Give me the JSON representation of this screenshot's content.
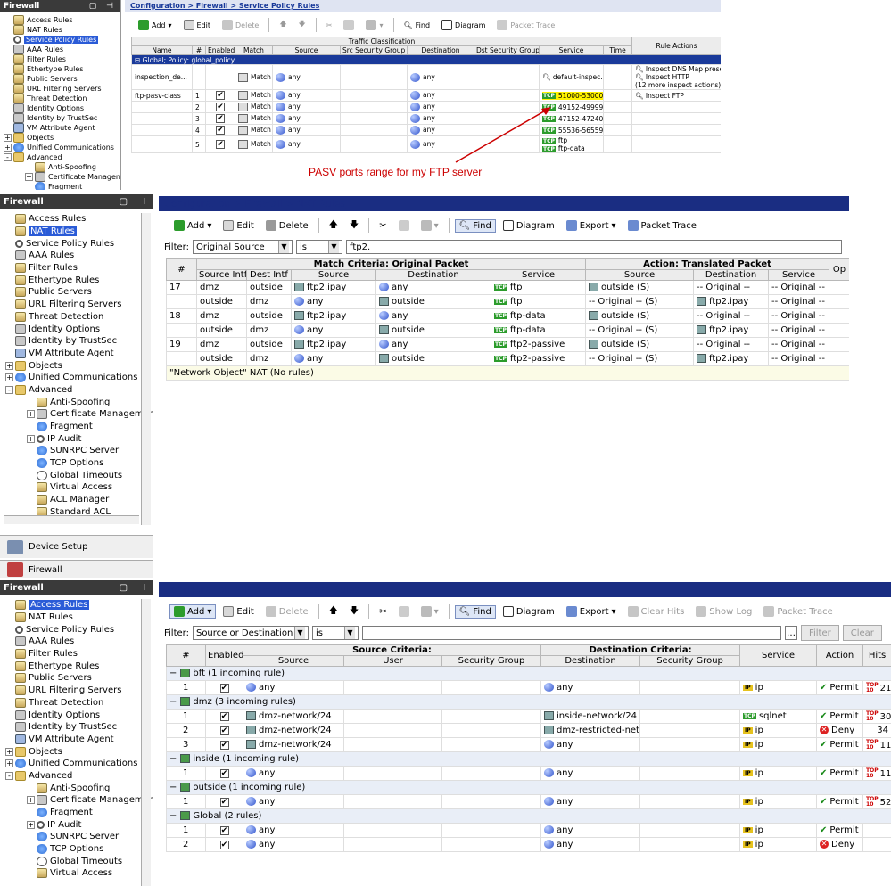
{
  "p1": {
    "sidebar_title": "Firewall",
    "sidebar_controls": "▢ ⊣",
    "tree": [
      {
        "label": "Access Rules",
        "icon": "rule"
      },
      {
        "label": "NAT Rules",
        "icon": "rule"
      },
      {
        "label": "Service Policy Rules",
        "icon": "mag",
        "selected": true
      },
      {
        "label": "AAA Rules",
        "icon": "key"
      },
      {
        "label": "Filter Rules",
        "icon": "rule"
      },
      {
        "label": "Ethertype Rules",
        "icon": "rule"
      },
      {
        "label": "Public Servers",
        "icon": "rule"
      },
      {
        "label": "URL Filtering Servers",
        "icon": "rule"
      },
      {
        "label": "Threat Detection",
        "icon": "rule"
      },
      {
        "label": "Identity Options",
        "icon": "key"
      },
      {
        "label": "Identity by TrustSec",
        "icon": "key"
      },
      {
        "label": "VM Attribute Agent",
        "icon": "vm"
      },
      {
        "label": "Objects",
        "icon": "folder",
        "exp": "+"
      },
      {
        "label": "Unified Communications",
        "icon": "globe",
        "exp": "+"
      },
      {
        "label": "Advanced",
        "icon": "folder",
        "exp": "-"
      },
      {
        "label": "Anti-Spoofing",
        "icon": "rule",
        "indent": 1
      },
      {
        "label": "Certificate Management",
        "icon": "key",
        "indent": 1,
        "exp": "+"
      },
      {
        "label": "Fragment",
        "icon": "globe",
        "indent": 1
      }
    ],
    "breadcrumb": "Configuration > Firewall > Service Policy Rules",
    "toolbar": {
      "add": "Add",
      "edit": "Edit",
      "delete": "Delete",
      "find": "Find",
      "diagram": "Diagram",
      "packet_trace": "Packet Trace"
    },
    "headers_top": {
      "traffic": "Traffic Classification",
      "rule_actions": "Rule Actions"
    },
    "headers": [
      "Name",
      "#",
      "Enabled",
      "Match",
      "Source",
      "Src Security Group",
      "Destination",
      "Dst Security Group",
      "Service",
      "Time"
    ],
    "group": "Global; Policy: global_policy",
    "rows": [
      {
        "name": "inspection_de...",
        "num": "",
        "enabled": false,
        "match": "Match",
        "source": "any",
        "dest": "any",
        "service": "default-inspec...",
        "svc_icon": "mag",
        "actions": [
          "Inspect DNS Map preset",
          "Inspect HTTP",
          "(12 more inspect actions)"
        ]
      },
      {
        "name": "ftp-pasv-class",
        "num": "1",
        "enabled": true,
        "match": "Match",
        "source": "any",
        "dest": "any",
        "service": "51000-53000",
        "highlight": true,
        "actions": [
          "Inspect FTP"
        ]
      },
      {
        "name": "",
        "num": "2",
        "enabled": true,
        "match": "Match",
        "source": "any",
        "dest": "any",
        "service": "49152-49999",
        "actions": []
      },
      {
        "name": "",
        "num": "3",
        "enabled": true,
        "match": "Match",
        "source": "any",
        "dest": "any",
        "service": "47152-47240",
        "actions": []
      },
      {
        "name": "",
        "num": "4",
        "enabled": true,
        "match": "Match",
        "source": "any",
        "dest": "any",
        "service": "55536-56559",
        "actions": []
      },
      {
        "name": "",
        "num": "5",
        "enabled": true,
        "match": "Match",
        "source": "any",
        "dest": "any",
        "service": "ftp",
        "service2": "ftp-data",
        "actions": []
      }
    ],
    "annotation": "PASV ports range for my FTP server"
  },
  "p2": {
    "sidebar_title": "Firewall",
    "sidebar_controls": "▢ ⊣",
    "tree": [
      {
        "label": "Access Rules",
        "icon": "rule"
      },
      {
        "label": "NAT Rules",
        "icon": "rule",
        "selected": true
      },
      {
        "label": "Service Policy Rules",
        "icon": "mag"
      },
      {
        "label": "AAA Rules",
        "icon": "key"
      },
      {
        "label": "Filter Rules",
        "icon": "rule"
      },
      {
        "label": "Ethertype Rules",
        "icon": "rule"
      },
      {
        "label": "Public Servers",
        "icon": "rule"
      },
      {
        "label": "URL Filtering Servers",
        "icon": "rule"
      },
      {
        "label": "Threat Detection",
        "icon": "rule"
      },
      {
        "label": "Identity Options",
        "icon": "key"
      },
      {
        "label": "Identity by TrustSec",
        "icon": "key"
      },
      {
        "label": "VM Attribute Agent",
        "icon": "vm"
      },
      {
        "label": "Objects",
        "icon": "folder",
        "exp": "+"
      },
      {
        "label": "Unified Communications",
        "icon": "globe",
        "exp": "+"
      },
      {
        "label": "Advanced",
        "icon": "folder",
        "exp": "-"
      },
      {
        "label": "Anti-Spoofing",
        "icon": "rule",
        "indent": 1
      },
      {
        "label": "Certificate Management",
        "icon": "key",
        "indent": 1,
        "exp": "+"
      },
      {
        "label": "Fragment",
        "icon": "globe",
        "indent": 1
      },
      {
        "label": "IP Audit",
        "icon": "mag",
        "indent": 1,
        "exp": "+"
      },
      {
        "label": "SUNRPC Server",
        "icon": "globe",
        "indent": 1
      },
      {
        "label": "TCP Options",
        "icon": "globe",
        "indent": 1
      },
      {
        "label": "Global Timeouts",
        "icon": "clock",
        "indent": 1
      },
      {
        "label": "Virtual Access",
        "icon": "rule",
        "indent": 1
      },
      {
        "label": "ACL Manager",
        "icon": "rule",
        "indent": 1
      },
      {
        "label": "Standard ACL",
        "icon": "rule",
        "indent": 1
      }
    ],
    "nav": {
      "device_setup": "Device Setup",
      "firewall": "Firewall"
    },
    "breadcrumb": "Configuration > Firewall > NAT Rules",
    "toolbar": {
      "add": "Add",
      "edit": "Edit",
      "delete": "Delete",
      "find": "Find",
      "diagram": "Diagram",
      "export": "Export",
      "packet_trace": "Packet Trace"
    },
    "filter": {
      "label": "Filter:",
      "field": "Original Source",
      "op": "is",
      "value": "ftp2."
    },
    "headers_top": {
      "match": "Match Criteria: Original Packet",
      "action": "Action: Translated Packet",
      "op": "Op"
    },
    "headers": [
      "#",
      "Source Intf",
      "Dest Intf",
      "Source",
      "Destination",
      "Service",
      "Source",
      "Destination",
      "Service"
    ],
    "rows": [
      {
        "num": "17",
        "si": "dmz",
        "di": "outside",
        "src": "ftp2.ipay",
        "dst": "any",
        "svc": "ftp",
        "tsrc": "outside (S)",
        "tdst": "-- Original --",
        "tsvc": "-- Original --"
      },
      {
        "num": "",
        "si": "outside",
        "di": "dmz",
        "src": "any",
        "dst": "outside",
        "svc": "ftp",
        "tsrc": "-- Original -- (S)",
        "tdst": "ftp2.ipay",
        "tsvc": "-- Original --"
      },
      {
        "num": "18",
        "si": "dmz",
        "di": "outside",
        "src": "ftp2.ipay",
        "dst": "any",
        "svc": "ftp-data",
        "tsrc": "outside (S)",
        "tdst": "-- Original --",
        "tsvc": "-- Original --"
      },
      {
        "num": "",
        "si": "outside",
        "di": "dmz",
        "src": "any",
        "dst": "outside",
        "svc": "ftp-data",
        "tsrc": "-- Original -- (S)",
        "tdst": "ftp2.ipay",
        "tsvc": "-- Original --"
      },
      {
        "num": "19",
        "si": "dmz",
        "di": "outside",
        "src": "ftp2.ipay",
        "dst": "any",
        "svc": "ftp2-passive",
        "tsrc": "outside (S)",
        "tdst": "-- Original --",
        "tsvc": "-- Original --"
      },
      {
        "num": "",
        "si": "outside",
        "di": "dmz",
        "src": "any",
        "dst": "outside",
        "svc": "ftp2-passive",
        "tsrc": "-- Original -- (S)",
        "tdst": "ftp2.ipay",
        "tsvc": "-- Original --"
      }
    ],
    "footer_group": "\"Network Object\" NAT (No rules)"
  },
  "p3": {
    "sidebar_title": "Firewall",
    "sidebar_controls": "▢ ⊣",
    "tree": [
      {
        "label": "Access Rules",
        "icon": "rule",
        "selected": true
      },
      {
        "label": "NAT Rules",
        "icon": "rule"
      },
      {
        "label": "Service Policy Rules",
        "icon": "mag"
      },
      {
        "label": "AAA Rules",
        "icon": "key"
      },
      {
        "label": "Filter Rules",
        "icon": "rule"
      },
      {
        "label": "Ethertype Rules",
        "icon": "rule"
      },
      {
        "label": "Public Servers",
        "icon": "rule"
      },
      {
        "label": "URL Filtering Servers",
        "icon": "rule"
      },
      {
        "label": "Threat Detection",
        "icon": "rule"
      },
      {
        "label": "Identity Options",
        "icon": "key"
      },
      {
        "label": "Identity by TrustSec",
        "icon": "key"
      },
      {
        "label": "VM Attribute Agent",
        "icon": "vm"
      },
      {
        "label": "Objects",
        "icon": "folder",
        "exp": "+"
      },
      {
        "label": "Unified Communications",
        "icon": "globe",
        "exp": "+"
      },
      {
        "label": "Advanced",
        "icon": "folder",
        "exp": "-"
      },
      {
        "label": "Anti-Spoofing",
        "icon": "rule",
        "indent": 1
      },
      {
        "label": "Certificate Management",
        "icon": "key",
        "indent": 1,
        "exp": "+"
      },
      {
        "label": "Fragment",
        "icon": "globe",
        "indent": 1
      },
      {
        "label": "IP Audit",
        "icon": "mag",
        "indent": 1,
        "exp": "+"
      },
      {
        "label": "SUNRPC Server",
        "icon": "globe",
        "indent": 1
      },
      {
        "label": "TCP Options",
        "icon": "globe",
        "indent": 1
      },
      {
        "label": "Global Timeouts",
        "icon": "clock",
        "indent": 1
      },
      {
        "label": "Virtual Access",
        "icon": "rule",
        "indent": 1
      }
    ],
    "breadcrumb": "Configuration > Firewall > Access Rules",
    "toolbar": {
      "add": "Add",
      "edit": "Edit",
      "delete": "Delete",
      "find": "Find",
      "diagram": "Diagram",
      "export": "Export",
      "clear_hits": "Clear Hits",
      "show_log": "Show Log",
      "packet_trace": "Packet Trace"
    },
    "filter": {
      "label": "Filter:",
      "field": "Source or Destination",
      "op": "is",
      "value": "",
      "filter_btn": "Filter",
      "clear_btn": "Clear"
    },
    "headers_top": {
      "src": "Source Criteria:",
      "dst": "Destination Criteria:"
    },
    "headers": [
      "#",
      "Enabled",
      "Source",
      "User",
      "Security Group",
      "Destination",
      "Security Group",
      "Service",
      "Action",
      "Hits"
    ],
    "groups": [
      {
        "title": "bft (1 incoming rule)",
        "rows": [
          {
            "num": "1",
            "src": "any",
            "src_type": "obj",
            "dst": "any",
            "dst_type": "obj",
            "svc": "ip",
            "svc_type": "ip",
            "action": "Permit",
            "hits": "21"
          }
        ]
      },
      {
        "title": "dmz (3 incoming rules)",
        "rows": [
          {
            "num": "1",
            "src": "dmz-network/24",
            "src_type": "net",
            "dst": "inside-network/24",
            "dst_type": "net",
            "svc": "sqlnet",
            "svc_type": "tcp",
            "action": "Permit",
            "hits": "30"
          },
          {
            "num": "2",
            "src": "dmz-network/24",
            "src_type": "net",
            "dst": "dmz-restricted-net...",
            "dst_type": "net",
            "svc": "ip",
            "svc_type": "ip",
            "action": "Deny",
            "hits": "34"
          },
          {
            "num": "3",
            "src": "dmz-network/24",
            "src_type": "net",
            "dst": "any",
            "dst_type": "obj",
            "svc": "ip",
            "svc_type": "ip",
            "action": "Permit",
            "hits": "11"
          }
        ]
      },
      {
        "title": "inside (1 incoming rule)",
        "rows": [
          {
            "num": "1",
            "src": "any",
            "src_type": "obj",
            "dst": "any",
            "dst_type": "obj",
            "svc": "ip",
            "svc_type": "ip",
            "action": "Permit",
            "hits": "11"
          }
        ]
      },
      {
        "title": "outside (1 incoming rule)",
        "rows": [
          {
            "num": "1",
            "src": "any",
            "src_type": "obj",
            "dst": "any",
            "dst_type": "obj",
            "svc": "ip",
            "svc_type": "ip",
            "action": "Permit",
            "hits": "52"
          }
        ]
      },
      {
        "title": "Global (2 rules)",
        "rows": [
          {
            "num": "1",
            "src": "any",
            "src_type": "obj",
            "dst": "any",
            "dst_type": "obj",
            "svc": "ip",
            "svc_type": "ip",
            "action": "Permit",
            "hits": ""
          },
          {
            "num": "2",
            "src": "any",
            "src_type": "obj",
            "dst": "any",
            "dst_type": "obj",
            "svc": "ip",
            "svc_type": "ip",
            "action": "Deny",
            "hits": ""
          }
        ]
      }
    ]
  }
}
